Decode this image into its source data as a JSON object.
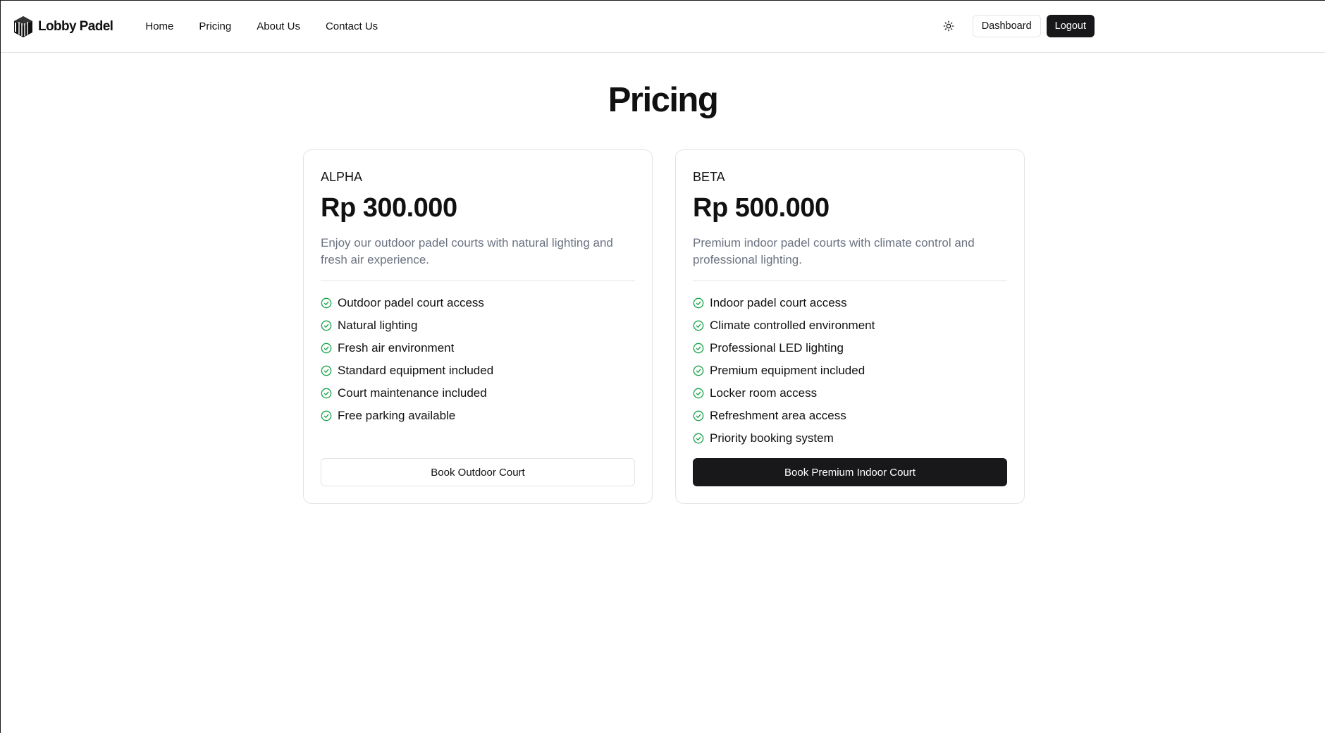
{
  "brand": {
    "name": "Lobby Padel",
    "logo_icon": "lobby-padel-logo-icon"
  },
  "nav": {
    "links": [
      "Home",
      "Pricing",
      "About Us",
      "Contact Us"
    ],
    "theme_icon": "sun-icon",
    "dashboard_label": "Dashboard",
    "logout_label": "Logout"
  },
  "page": {
    "title": "Pricing"
  },
  "plans": [
    {
      "name": "ALPHA",
      "price": "Rp 300.000",
      "description": "Enjoy our outdoor padel courts with natural lighting and fresh air experience.",
      "features": [
        "Outdoor padel court access",
        "Natural lighting",
        "Fresh air environment",
        "Standard equipment included",
        "Court maintenance included",
        "Free parking available"
      ],
      "button_label": "Book Outdoor Court"
    },
    {
      "name": "BETA",
      "price": "Rp 500.000",
      "description": "Premium indoor padel courts with climate control and professional lighting.",
      "features": [
        "Indoor padel court access",
        "Climate controlled environment",
        "Professional LED lighting",
        "Premium equipment included",
        "Locker room access",
        "Refreshment area access",
        "Priority booking system"
      ],
      "button_label": "Book Premium Indoor Court"
    }
  ],
  "colors": {
    "check": "#16a34a",
    "primary": "#18181b",
    "muted_text": "#6b7280",
    "border": "#e4e4e7"
  }
}
